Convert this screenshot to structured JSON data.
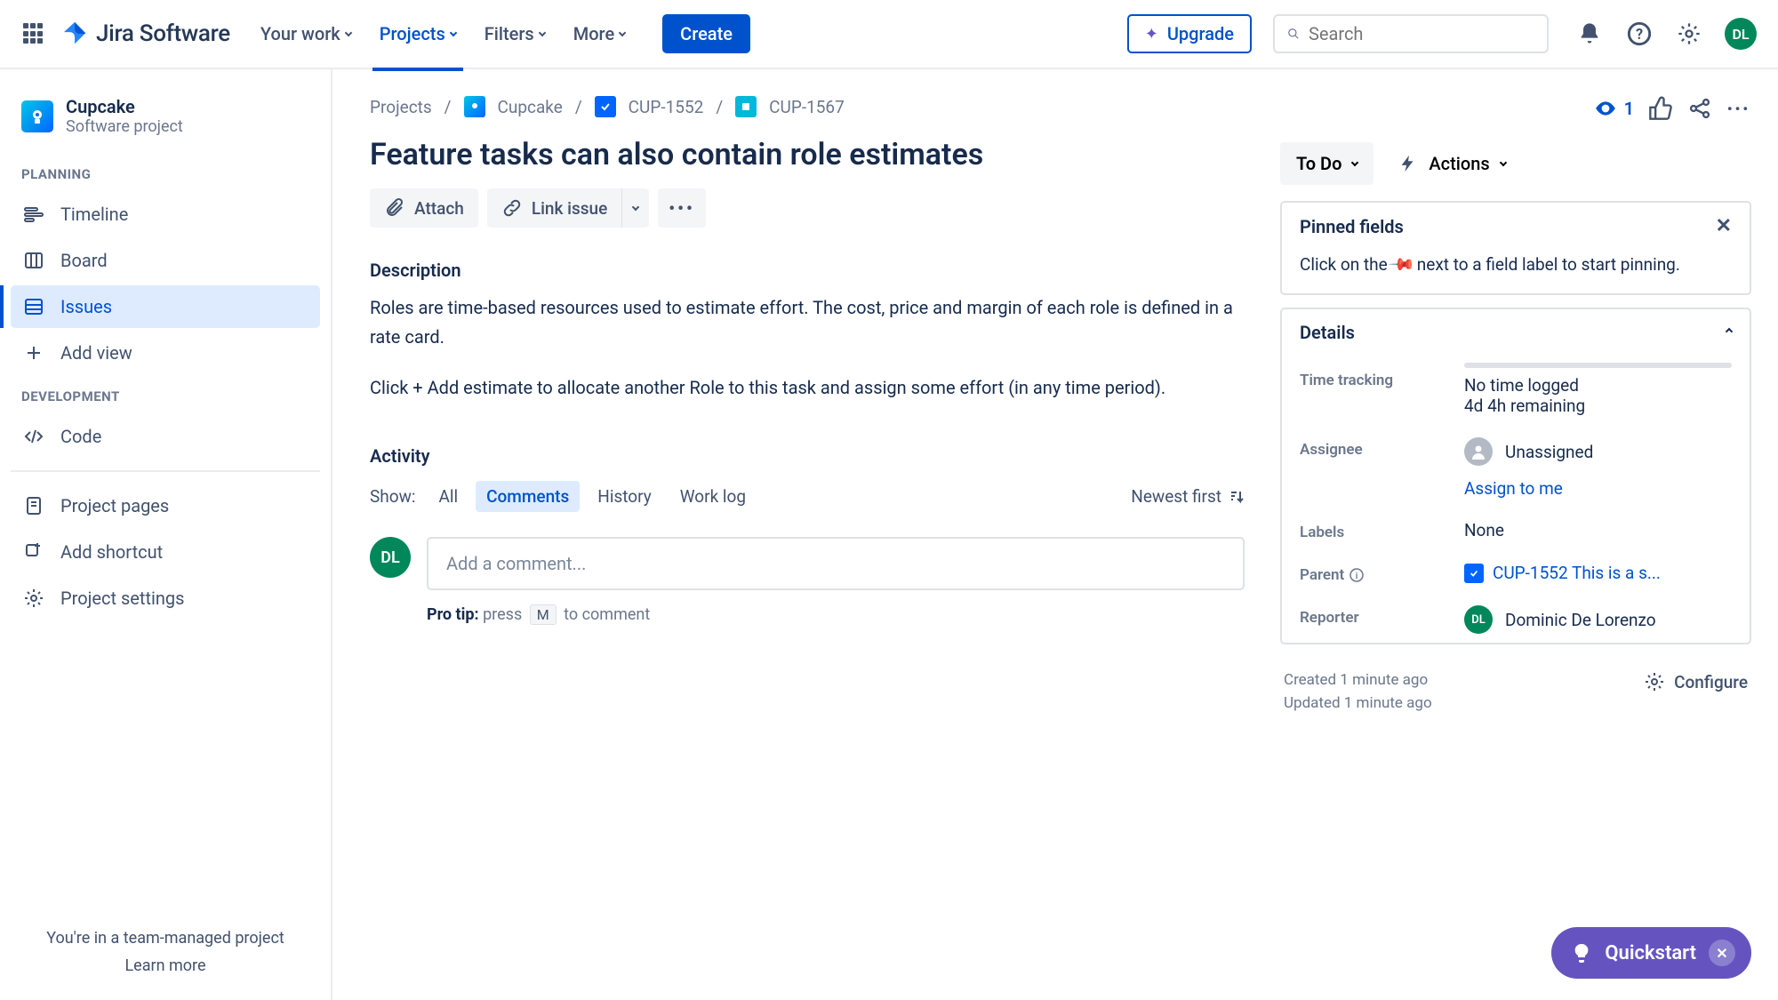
{
  "nav": {
    "product": "Jira Software",
    "items": [
      "Your work",
      "Projects",
      "Filters",
      "More"
    ],
    "active_index": 1,
    "create": "Create",
    "upgrade": "Upgrade",
    "search_placeholder": "Search",
    "avatar_initials": "DL"
  },
  "sidebar": {
    "project_name": "Cupcake",
    "project_sub": "Software project",
    "sections": {
      "planning": "PLANNING",
      "development": "DEVELOPMENT"
    },
    "items": {
      "timeline": "Timeline",
      "board": "Board",
      "issues": "Issues",
      "add_view": "Add view",
      "code": "Code",
      "project_pages": "Project pages",
      "add_shortcut": "Add shortcut",
      "project_settings": "Project settings"
    },
    "footer_text": "You're in a team-managed project",
    "footer_link": "Learn more"
  },
  "breadcrumb": {
    "projects": "Projects",
    "project": "Cupcake",
    "parent_key": "CUP-1552",
    "issue_key": "CUP-1567"
  },
  "issue": {
    "title": "Feature tasks can also contain role estimates",
    "attach": "Attach",
    "link_issue": "Link issue",
    "description_label": "Description",
    "description_p1": "Roles are time-based resources used to estimate effort. The cost, price and margin of each role is defined in a rate card.",
    "description_p2": "Click + Add estimate to allocate another Role to this task and assign some effort (in any time period)."
  },
  "activity": {
    "heading": "Activity",
    "show": "Show:",
    "tabs": [
      "All",
      "Comments",
      "History",
      "Work log"
    ],
    "active_tab": 1,
    "sort": "Newest first",
    "comment_placeholder": "Add a comment...",
    "protip_label": "Pro tip:",
    "protip_before": " press ",
    "protip_key": "M",
    "protip_after": " to comment",
    "avatar_initials": "DL"
  },
  "rail": {
    "watchers": "1",
    "status": "To Do",
    "actions": "Actions",
    "pinned_head": "Pinned fields",
    "pinned_body_a": "Click on the ",
    "pinned_body_b": " next to a field label to start pinning.",
    "details_head": "Details",
    "fields": {
      "time_tracking": "Time tracking",
      "tt_line1": "No time logged",
      "tt_line2": "4d 4h remaining",
      "assignee": "Assignee",
      "assignee_value": "Unassigned",
      "assign_to_me": "Assign to me",
      "labels": "Labels",
      "labels_value": "None",
      "parent": "Parent",
      "parent_value": "CUP-1552 This is a s...",
      "reporter": "Reporter",
      "reporter_value": "Dominic De Lorenzo",
      "reporter_initials": "DL"
    },
    "created": "Created 1 minute ago",
    "updated": "Updated 1 minute ago",
    "configure": "Configure"
  },
  "quickstart": {
    "label": "Quickstart"
  }
}
